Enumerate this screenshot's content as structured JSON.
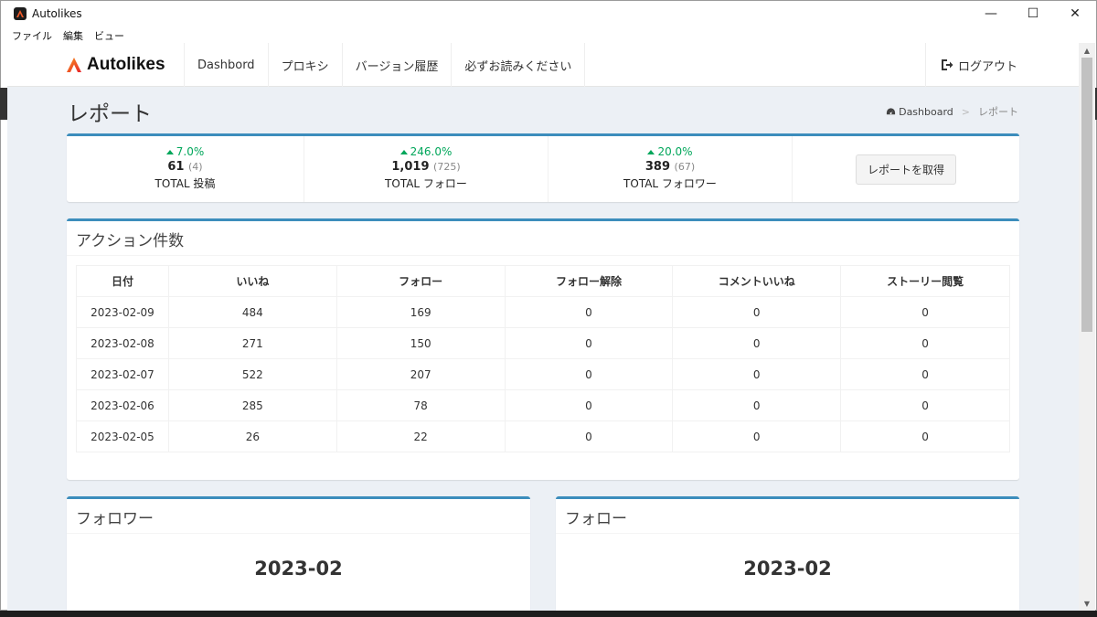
{
  "window": {
    "title": "Autolikes",
    "controls": {
      "minimize": "—",
      "maximize": "☐",
      "close": "✕"
    }
  },
  "menu": [
    "ファイル",
    "編集",
    "ビュー"
  ],
  "navbar": {
    "brand": "Autolikes",
    "items": [
      "Dashbord",
      "プロキシ",
      "バージョン履歴",
      "必ずお読みください"
    ],
    "logout": "ログアウト"
  },
  "header": {
    "title": "レポート",
    "breadcrumb": {
      "home": "Dashboard",
      "sep": ">",
      "current": "レポート"
    }
  },
  "stats": [
    {
      "pct": "7.0%",
      "value": "61",
      "prev": "(4)",
      "label": "TOTAL 投稿"
    },
    {
      "pct": "246.0%",
      "value": "1,019",
      "prev": "(725)",
      "label": "TOTAL フォロー"
    },
    {
      "pct": "20.0%",
      "value": "389",
      "prev": "(67)",
      "label": "TOTAL フォロワー"
    }
  ],
  "report_button": "レポートを取得",
  "actions": {
    "title": "アクション件数",
    "columns": [
      "日付",
      "いいね",
      "フォロー",
      "フォロー解除",
      "コメントいいね",
      "ストーリー閲覧"
    ],
    "rows": [
      [
        "2023-02-09",
        "484",
        "169",
        "0",
        "0",
        "0"
      ],
      [
        "2023-02-08",
        "271",
        "150",
        "0",
        "0",
        "0"
      ],
      [
        "2023-02-07",
        "522",
        "207",
        "0",
        "0",
        "0"
      ],
      [
        "2023-02-06",
        "285",
        "78",
        "0",
        "0",
        "0"
      ],
      [
        "2023-02-05",
        "26",
        "22",
        "0",
        "0",
        "0"
      ]
    ]
  },
  "charts": [
    {
      "title": "フォロワー",
      "period": "2023-02"
    },
    {
      "title": "フォロー",
      "period": "2023-02"
    }
  ],
  "colors": {
    "accent": "#3c8dbc",
    "success": "#00a65a",
    "background": "#ecf0f5"
  }
}
